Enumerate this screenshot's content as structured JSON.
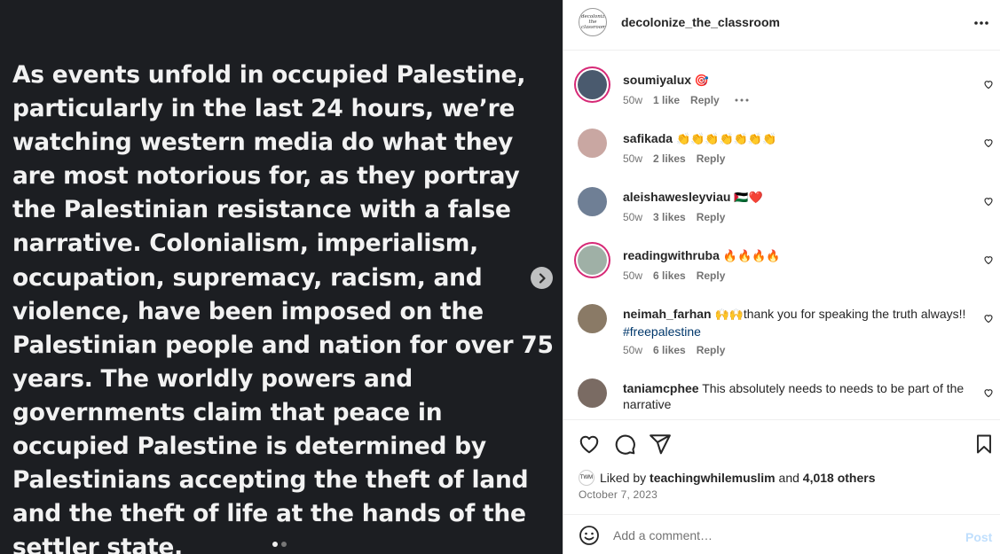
{
  "media": {
    "text": "As events unfold in occupied Palestine, particularly in the last 24 hours, we’re watching western media do what they are most notorious for, as they portray the Palestinian resistance with a false narrative. Colonialism, imperialism, occupation, supremacy, racism, and violence, have been imposed on the Palestinian people and nation for over 75 years. The worldly powers and governments claim that peace in occupied Palestine is determined by Palestinians accepting the theft of land and the theft of life at the hands of the settler state.",
    "next_icon": "chevron-right-icon",
    "carousel": {
      "count": 2,
      "active": 1
    }
  },
  "header": {
    "username": "decolonize_the_classroom",
    "avatar_text": "decolonize the classroom",
    "more_icon": "more-horizontal-icon"
  },
  "comments": [
    {
      "username": "soumiyalux",
      "emoji": "🎯",
      "text": "",
      "hashtag": "",
      "time": "50w",
      "likes": "1 like",
      "reply": "Reply",
      "show_more": true,
      "avatar_color": "#4a5a6e",
      "ring": true
    },
    {
      "username": "safikada",
      "emoji": "👏👏👏👏👏👏👏",
      "text": "",
      "hashtag": "",
      "time": "50w",
      "likes": "2 likes",
      "reply": "Reply",
      "show_more": false,
      "avatar_color": "#c9a7a2",
      "ring": false
    },
    {
      "username": "aleishawesleyviau",
      "emoji": "🇵🇸❤️",
      "text": "",
      "hashtag": "",
      "time": "50w",
      "likes": "3 likes",
      "reply": "Reply",
      "show_more": false,
      "avatar_color": "#6f7f95",
      "ring": false
    },
    {
      "username": "readingwithruba",
      "emoji": "🔥🔥🔥🔥",
      "text": "",
      "hashtag": "",
      "time": "50w",
      "likes": "6 likes",
      "reply": "Reply",
      "show_more": false,
      "avatar_color": "#9fb0a6",
      "ring": true
    },
    {
      "username": "neimah_farhan",
      "emoji": "🙌🙌",
      "text": "thank you for speaking the truth always!!",
      "hashtag": "#freepalestine",
      "time": "50w",
      "likes": "6 likes",
      "reply": "Reply",
      "show_more": false,
      "avatar_color": "#8a7a66",
      "ring": false
    },
    {
      "username": "taniamcphee",
      "emoji": "",
      "text": "This absolutely needs to needs to be part of the narrative",
      "hashtag": "",
      "time": "",
      "likes": "",
      "reply": "",
      "show_more": false,
      "avatar_color": "#7a6b63",
      "ring": false
    }
  ],
  "actions": {
    "like_icon": "heart-icon",
    "comment_icon": "comment-icon",
    "share_icon": "send-icon",
    "save_icon": "bookmark-icon",
    "liked_prefix": "Liked by",
    "liked_user": "teachingwhilemuslim",
    "liked_and": "and",
    "liked_others": "4,018 others",
    "liked_avatar_text": "TWM",
    "date": "October 7, 2023"
  },
  "composer": {
    "emoji_icon": "smiley-icon",
    "placeholder": "Add a comment…",
    "post_label": "Post"
  }
}
